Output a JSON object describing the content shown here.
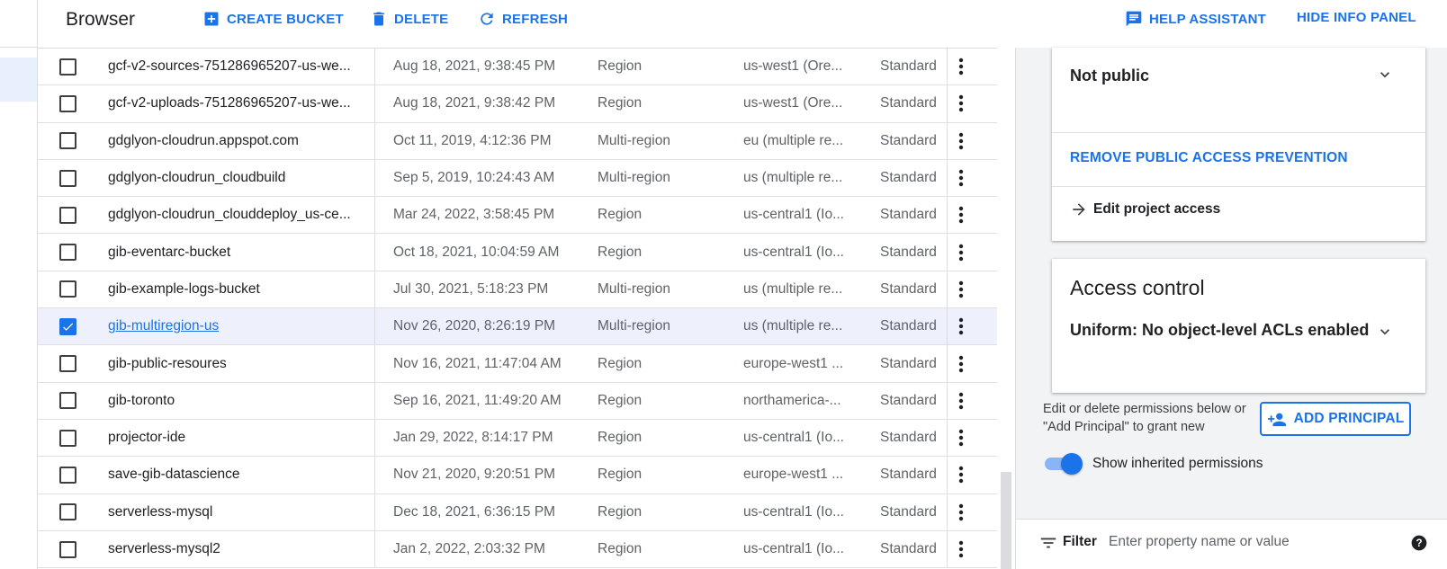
{
  "header": {
    "title": "Browser",
    "create_bucket": "CREATE BUCKET",
    "delete": "DELETE",
    "refresh": "REFRESH",
    "help_assistant": "HELP ASSISTANT",
    "hide_info_panel": "HIDE INFO PANEL"
  },
  "buckets": [
    {
      "name": "gcf-v2-sources-751286965207-us-we...",
      "created": "Aug 18, 2021, 9:38:45 PM",
      "location_type": "Region",
      "location": "us-west1 (Ore...",
      "storage_class": "Standard",
      "checked": false
    },
    {
      "name": "gcf-v2-uploads-751286965207-us-we...",
      "created": "Aug 18, 2021, 9:38:42 PM",
      "location_type": "Region",
      "location": "us-west1 (Ore...",
      "storage_class": "Standard",
      "checked": false
    },
    {
      "name": "gdglyon-cloudrun.appspot.com",
      "created": "Oct 11, 2019, 4:12:36 PM",
      "location_type": "Multi-region",
      "location": "eu (multiple re...",
      "storage_class": "Standard",
      "checked": false
    },
    {
      "name": "gdglyon-cloudrun_cloudbuild",
      "created": "Sep 5, 2019, 10:24:43 AM",
      "location_type": "Multi-region",
      "location": "us (multiple re...",
      "storage_class": "Standard",
      "checked": false
    },
    {
      "name": "gdglyon-cloudrun_clouddeploy_us-ce...",
      "created": "Mar 24, 2022, 3:58:45 PM",
      "location_type": "Region",
      "location": "us-central1 (Io...",
      "storage_class": "Standard",
      "checked": false
    },
    {
      "name": "gib-eventarc-bucket",
      "created": "Oct 18, 2021, 10:04:59 AM",
      "location_type": "Region",
      "location": "us-central1 (Io...",
      "storage_class": "Standard",
      "checked": false
    },
    {
      "name": "gib-example-logs-bucket",
      "created": "Jul 30, 2021, 5:18:23 PM",
      "location_type": "Multi-region",
      "location": "us (multiple re...",
      "storage_class": "Standard",
      "checked": false
    },
    {
      "name": "gib-multiregion-us",
      "created": "Nov 26, 2020, 8:26:19 PM",
      "location_type": "Multi-region",
      "location": "us (multiple re...",
      "storage_class": "Standard",
      "checked": true
    },
    {
      "name": "gib-public-resoures",
      "created": "Nov 16, 2021, 11:47:04 AM",
      "location_type": "Region",
      "location": "europe-west1 ...",
      "storage_class": "Standard",
      "checked": false
    },
    {
      "name": "gib-toronto",
      "created": "Sep 16, 2021, 11:49:20 AM",
      "location_type": "Region",
      "location": "northamerica-...",
      "storage_class": "Standard",
      "checked": false
    },
    {
      "name": "projector-ide",
      "created": "Jan 29, 2022, 8:14:17 PM",
      "location_type": "Region",
      "location": "us-central1 (Io...",
      "storage_class": "Standard",
      "checked": false
    },
    {
      "name": "save-gib-datascience",
      "created": "Nov 21, 2020, 9:20:51 PM",
      "location_type": "Region",
      "location": "europe-west1 ...",
      "storage_class": "Standard",
      "checked": false
    },
    {
      "name": "serverless-mysql",
      "created": "Dec 18, 2021, 6:36:15 PM",
      "location_type": "Region",
      "location": "us-central1 (Io...",
      "storage_class": "Standard",
      "checked": false
    },
    {
      "name": "serverless-mysql2",
      "created": "Jan 2, 2022, 2:03:32 PM",
      "location_type": "Region",
      "location": "us-central1 (Io...",
      "storage_class": "Standard",
      "checked": false
    }
  ],
  "info_panel": {
    "public_access": {
      "value": "Not public",
      "remove_prevention": "REMOVE PUBLIC ACCESS PREVENTION",
      "edit_project_access": "Edit project access"
    },
    "access_control": {
      "title": "Access control",
      "value": "Uniform: No object-level ACLs enabled"
    },
    "permissions_hint": "Edit or delete permissions below or \"Add Principal\" to grant new",
    "add_principal": "ADD PRINCIPAL",
    "show_inherited": {
      "label": "Show inherited permissions",
      "enabled": true
    },
    "filter": {
      "label": "Filter",
      "placeholder": "Enter property name or value"
    }
  },
  "colors": {
    "accent": "#1a73e8",
    "selected_row": "#eef1fb",
    "panel_bg": "#f1f3f4"
  }
}
